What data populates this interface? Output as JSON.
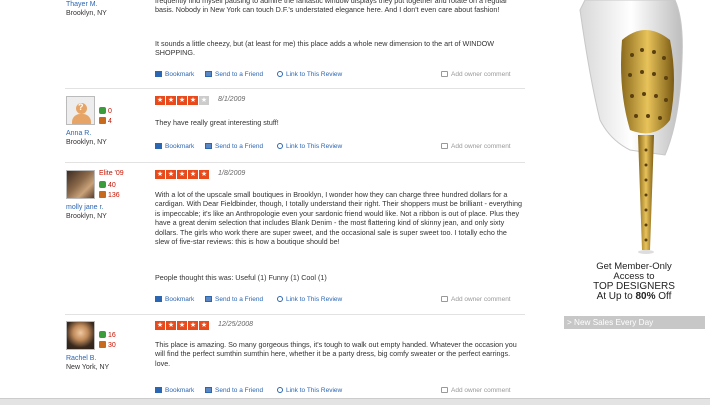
{
  "actions": {
    "bookmark": "Bookmark",
    "send": "Send to a Friend",
    "link": "Link to This Review",
    "owner": "Add owner comment"
  },
  "reviews": [
    {
      "name": "Thayer M.",
      "location": "Brooklyn, NY",
      "text1": "frequently find myself pausing to admire the fantastic window displays they put together and rotate on a regular basis.  Nobody in New York can touch D.F.'s understated elegance here.  And I don't even care about fashion!",
      "text2": "It sounds a little cheezy, but (at least for me) this place adds a whole new dimension to the art of WINDOW SHOPPING."
    },
    {
      "name": "Anna R.",
      "location": "Brooklyn, NY",
      "friends": "0",
      "reviews_count": "4",
      "rating": 4,
      "date": "8/1/2009",
      "text": "They have really great interesting stuff!"
    },
    {
      "name": "molly jane r.",
      "location": "Brooklyn, NY",
      "elite": "Elite '09",
      "friends": "40",
      "reviews_count": "136",
      "rating": 5,
      "date": "1/8/2009",
      "text": "With a lot of the upscale small boutiques in Brooklyn, I wonder how they can charge three hundred dollars for a cardigan. With Dear Fieldbinder, though, I totally understand their right. Their shoppers must be brilliant - everything is impeccable; it's like an Anthropologie even your sardonic friend would like. Not a ribbon is out of place. Plus they have a great denim selection that includes Blank Denim - the most flattering kind of skinny jean, and only sixty dollars. The girls who work there are super sweet, and the occasional sale is super sweet too. I totally echo the slew of five-star reviews: this is how a boutique should be!",
      "votes": "People thought this was:  Useful (1)   Funny (1)   Cool (1)"
    },
    {
      "name": "Rachel B.",
      "location": "New York, NY",
      "friends": "16",
      "reviews_count": "30",
      "rating": 5,
      "date": "12/25/2008",
      "text": "This place is amazing. So many gorgeous things, it's tough to walk out empty handed. Whatever the occasion you will find the perfect sumthin sumthin here, whether it be a party dress, big comfy sweater or the perfect earrings. love."
    }
  ],
  "ad": {
    "line1": "Get Member-Only",
    "line2": "Access to",
    "line3": "TOP DESIGNERS",
    "line4_pre": "At Up to ",
    "line4_bold": "80%",
    "line4_post": " Off",
    "button": "> New Sales Every Day"
  },
  "colors": {
    "link": "#2b66b3",
    "star": "#e84a1c",
    "accent_red": "#c41200"
  }
}
